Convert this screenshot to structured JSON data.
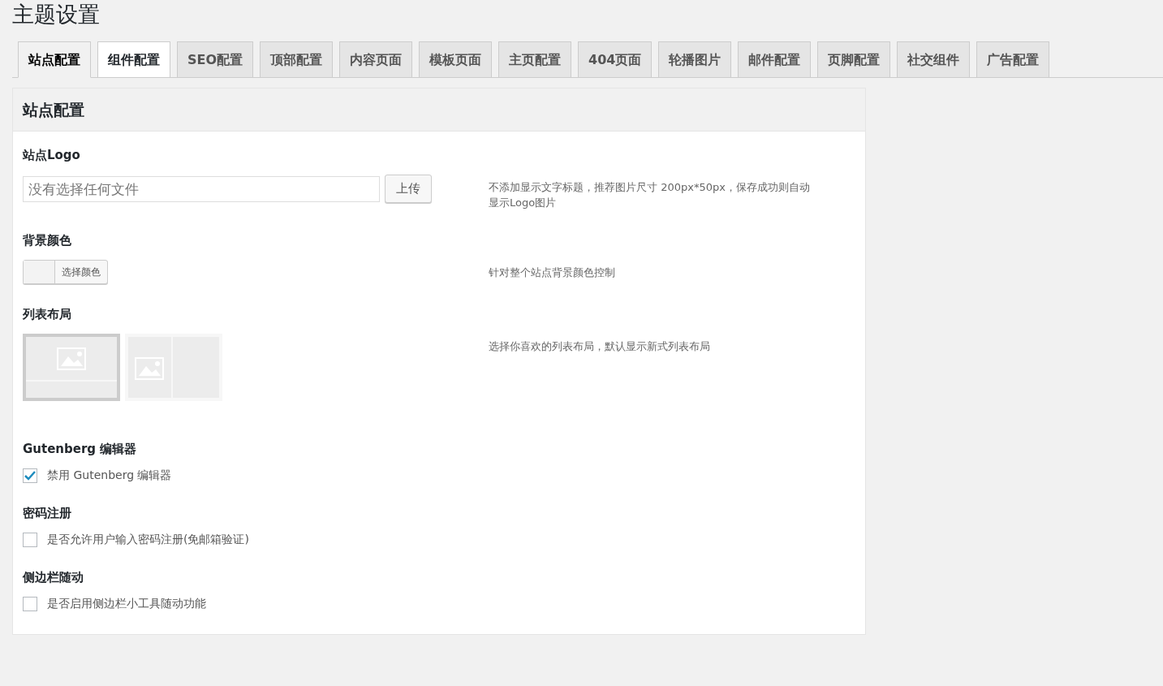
{
  "page_title": "主题设置",
  "tabs": [
    {
      "label": "站点配置",
      "selected": true,
      "hovered": false
    },
    {
      "label": "组件配置",
      "selected": false,
      "hovered": true
    },
    {
      "label": "SEO配置",
      "selected": false,
      "hovered": false
    },
    {
      "label": "顶部配置",
      "selected": false,
      "hovered": false
    },
    {
      "label": "内容页面",
      "selected": false,
      "hovered": false
    },
    {
      "label": "模板页面",
      "selected": false,
      "hovered": false
    },
    {
      "label": "主页配置",
      "selected": false,
      "hovered": false
    },
    {
      "label": "404页面",
      "selected": false,
      "hovered": false
    },
    {
      "label": "轮播图片",
      "selected": false,
      "hovered": false
    },
    {
      "label": "邮件配置",
      "selected": false,
      "hovered": false
    },
    {
      "label": "页脚配置",
      "selected": false,
      "hovered": false
    },
    {
      "label": "社交组件",
      "selected": false,
      "hovered": false
    },
    {
      "label": "广告配置",
      "selected": false,
      "hovered": false
    }
  ],
  "panel": {
    "title": "站点配置",
    "sections": [
      {
        "kind": "upload",
        "label": "站点Logo",
        "placeholder": "没有选择任何文件",
        "button": "上传",
        "description": "不添加显示文字标题，推荐图片尺寸 200px*50px，保存成功则自动显示Logo图片"
      },
      {
        "kind": "color",
        "label": "背景颜色",
        "button": "选择颜色",
        "description": "针对整个站点背景颜色控制"
      },
      {
        "kind": "layout",
        "label": "列表布局",
        "options": [
          {
            "kind": "wide",
            "selected": true
          },
          {
            "kind": "split",
            "selected": false
          }
        ],
        "description": "选择你喜欢的列表布局，默认显示新式列表布局"
      },
      {
        "kind": "checkbox",
        "label": "Gutenberg 编辑器",
        "option": "禁用 Gutenberg 编辑器",
        "checked": true
      },
      {
        "kind": "checkbox",
        "label": "密码注册",
        "option": "是否允许用户输入密码注册(免邮箱验证)",
        "checked": false
      },
      {
        "kind": "checkbox",
        "label": "侧边栏随动",
        "option": "是否启用侧边栏小工具随动功能",
        "checked": false
      }
    ]
  }
}
